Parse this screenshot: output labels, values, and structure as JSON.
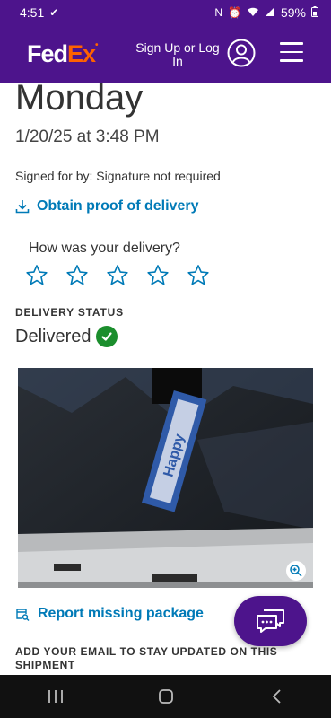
{
  "status_bar": {
    "time": "4:51",
    "battery": "59%"
  },
  "header": {
    "logo_fed": "Fed",
    "logo_ex": "Ex",
    "signup_label": "Sign Up or Log In"
  },
  "delivery": {
    "day": "Monday",
    "datetime": "1/20/25 at 3:48 PM",
    "signed_for": "Signed for by: Signature not required",
    "proof_link": "Obtain proof of delivery"
  },
  "rating": {
    "question": "How was your delivery?",
    "stars": 5,
    "selected": 0
  },
  "status": {
    "label": "DELIVERY STATUS",
    "value": "Delivered"
  },
  "report_link": "Report missing package",
  "email_section": {
    "title": "ADD YOUR EMAIL TO STAY UPDATED ON THIS SHIPMENT"
  },
  "colors": {
    "brand_purple": "#4d148c",
    "brand_orange": "#ff6200",
    "link_blue": "#007ab7",
    "success_green": "#1b8e2d"
  }
}
